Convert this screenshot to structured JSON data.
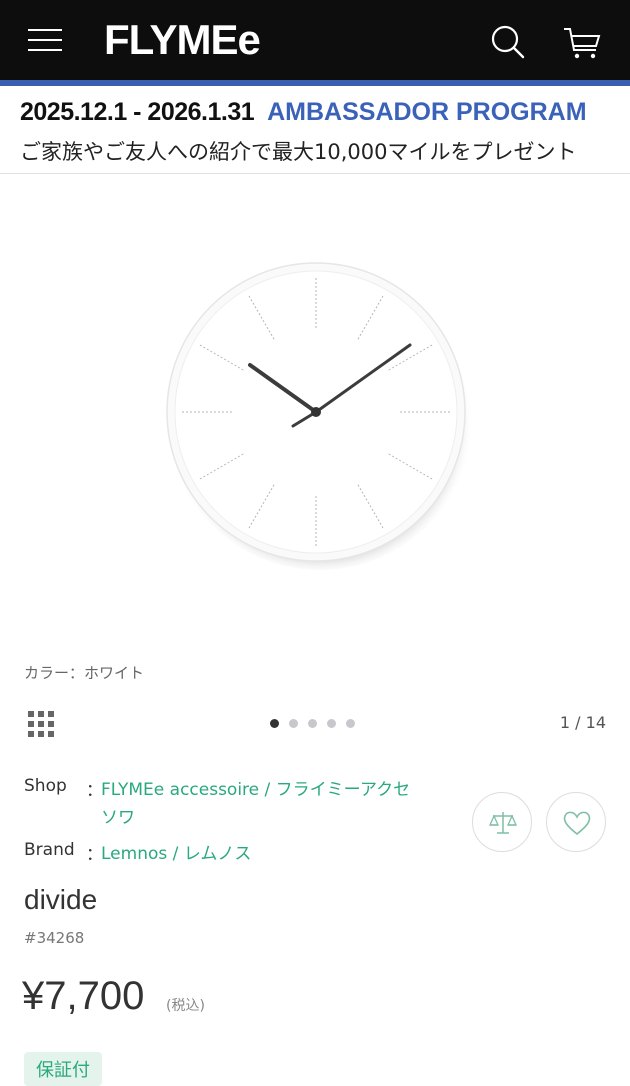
{
  "header": {
    "logo": "FLYMEe",
    "menu_icon": "hamburger-menu-icon",
    "search_icon": "search-icon",
    "cart_icon": "cart-icon",
    "background": "#0d0d0d",
    "accent_bar": "#3a5fb0"
  },
  "promo": {
    "dates": "2025.12.1 - 2026.1.31",
    "program": "AMBASSADOR PROGRAM",
    "description": "ご家族やご友人への紹介で最大10,000マイルをプレゼント",
    "program_color": "#3a62b8"
  },
  "product": {
    "color_label": "カラー：ホワイト",
    "gallery": {
      "current": 1,
      "total": 14,
      "counter": "1 / 14",
      "dot_count": 5
    },
    "shop_key": "Shop",
    "shop_value": "FLYMEe accessoire / フライミーアクセソワ",
    "brand_key": "Brand",
    "brand_value": "Lemnos / レムノス",
    "separator": "：",
    "name": "divide",
    "code": "#34268",
    "price": "¥7,700",
    "tax_note": "(税込)",
    "warranty_badge": "保証付",
    "link_color": "#2aa97c"
  }
}
